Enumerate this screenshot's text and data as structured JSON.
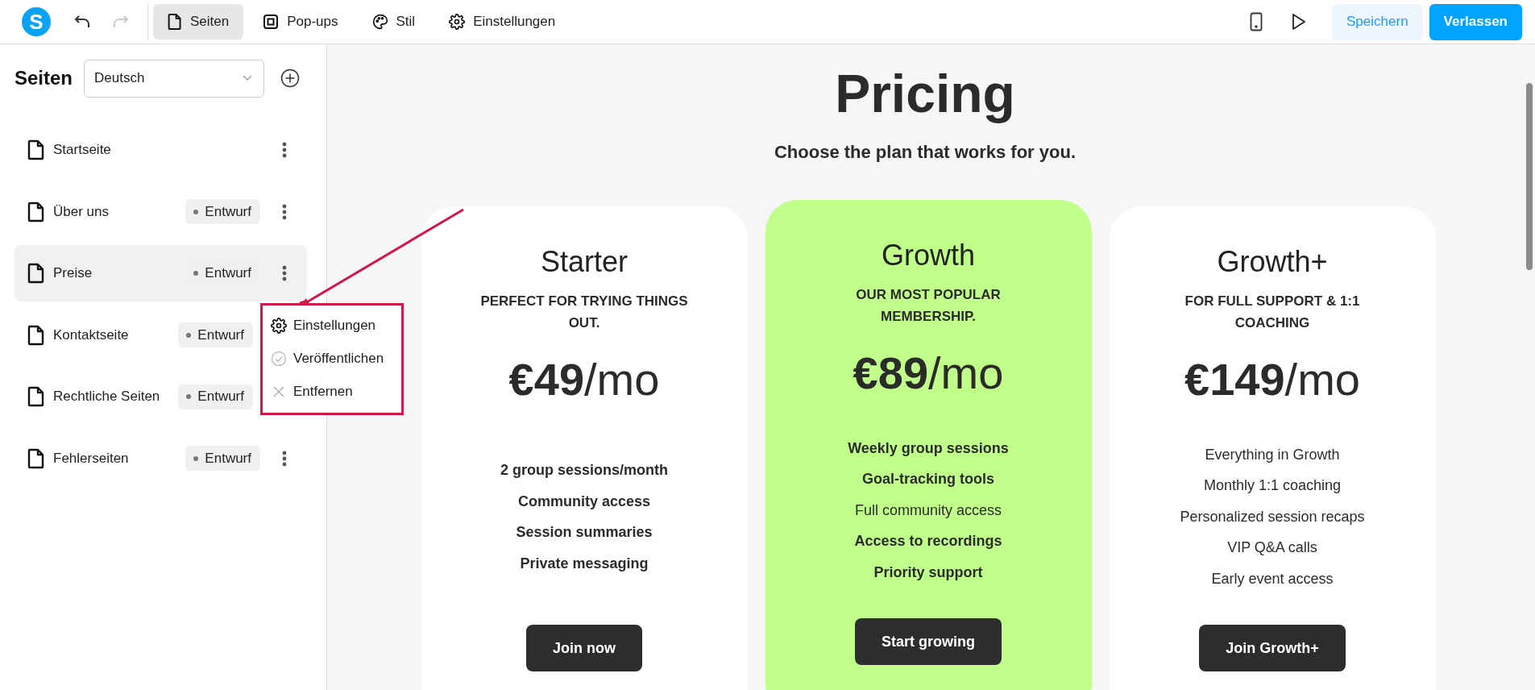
{
  "toolbar": {
    "logo": "S",
    "undo_disabled": false,
    "redo_disabled": true,
    "tabs": [
      {
        "label": "Seiten",
        "selected": true
      },
      {
        "label": "Pop-ups",
        "selected": false
      },
      {
        "label": "Stil",
        "selected": false
      },
      {
        "label": "Einstellungen",
        "selected": false
      }
    ],
    "buttons": [
      {
        "label": "Speichern",
        "kind": "secondary"
      },
      {
        "label": "Verlassen",
        "kind": "primary"
      }
    ]
  },
  "sidebar": {
    "title": "Seiten",
    "language": "Deutsch",
    "pages": [
      {
        "name": "Startseite",
        "selected": false
      },
      {
        "name": "Über uns",
        "status": "Entwurf",
        "selected": false
      },
      {
        "name": "Preise",
        "status": "Entwurf",
        "selected": true,
        "menu": [
          {
            "label": "Einstellungen",
            "kind": "settings"
          },
          {
            "label": "Veröffentlichen",
            "kind": "publish"
          },
          {
            "label": "Entfernen",
            "kind": "remove"
          }
        ]
      },
      {
        "name": "Kontaktseite",
        "status": "Entwurf",
        "selected": false
      },
      {
        "name": "Rechtliche Seiten",
        "status": "Entwurf",
        "selected": false
      },
      {
        "name": "Fehlerseiten",
        "status": "Entwurf",
        "selected": false
      }
    ]
  },
  "preview": {
    "title": "Pricing",
    "subtitle": "Choose the plan that works for you.",
    "plans": [
      {
        "name": "Starter",
        "tagline": "PERFECT FOR TRYING THINGS OUT.",
        "amount": "€49",
        "period": "/mo",
        "featured": false,
        "button": "Join now",
        "features": [
          {
            "text": "2 group sessions/month",
            "bold": true
          },
          {
            "text": "Community access",
            "bold": true
          },
          {
            "text": "Session summaries",
            "bold": true
          },
          {
            "text": "Private messaging",
            "bold": true
          }
        ]
      },
      {
        "name": "Growth",
        "tagline": "OUR MOST POPULAR MEMBERSHIP.",
        "amount": "€89",
        "period": "/mo",
        "featured": true,
        "color": "#bfff8a",
        "button": "Start growing",
        "features": [
          {
            "text": "Weekly group sessions",
            "bold": true
          },
          {
            "text": "Goal-tracking tools",
            "bold": true
          },
          {
            "text": "Full community access",
            "bold": false
          },
          {
            "text": "Access to recordings",
            "bold": true
          },
          {
            "text": "Priority support",
            "bold": true
          }
        ]
      },
      {
        "name": "Growth+",
        "tagline": "FOR FULL SUPPORT & 1:1 COACHING",
        "amount": "€149",
        "period": "/mo",
        "featured": false,
        "button": "Join Growth+",
        "features": [
          {
            "text": "Everything in Growth",
            "bold": false
          },
          {
            "text": "Monthly 1:1 coaching",
            "bold": false
          },
          {
            "text": "Personalized session recaps",
            "bold": false
          },
          {
            "text": "VIP Q&A calls",
            "bold": false
          },
          {
            "text": "Early event access",
            "bold": false
          }
        ]
      }
    ]
  }
}
